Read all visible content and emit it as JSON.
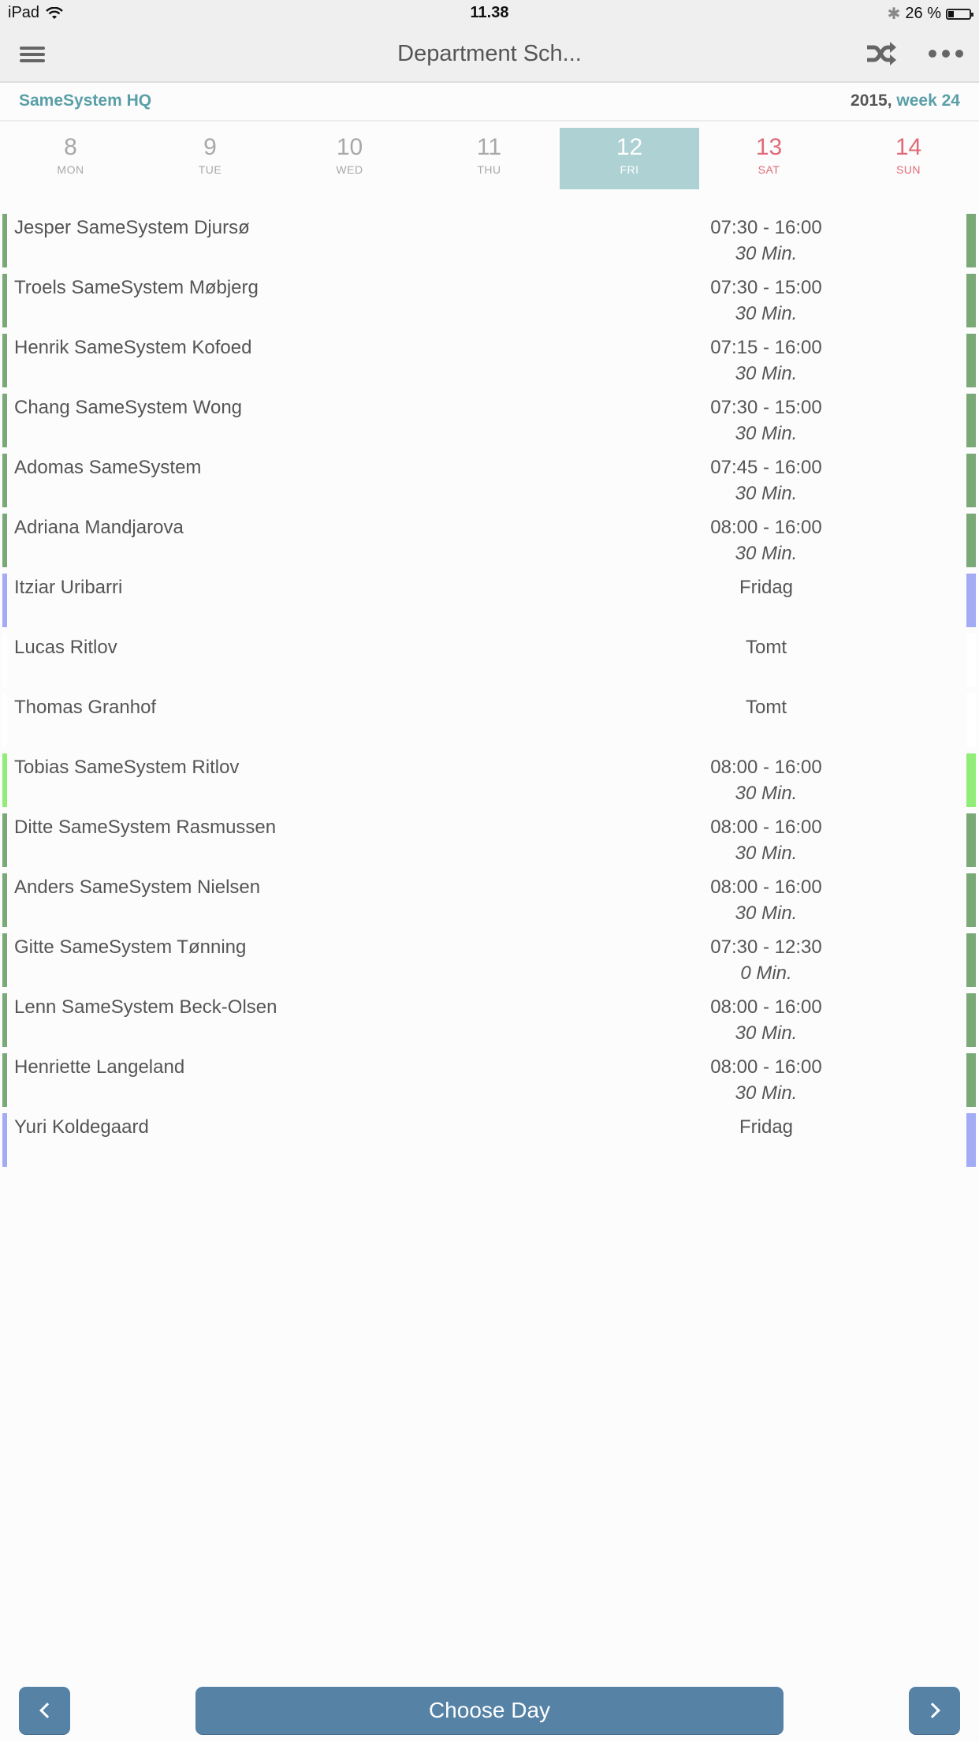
{
  "status_bar": {
    "device": "iPad",
    "time": "11.38",
    "battery_text": "26 %",
    "battery_level": 0.26
  },
  "nav": {
    "title": "Department Sch...",
    "menu_icon": "hamburger-menu-icon",
    "shuffle_icon": "shuffle-icon",
    "more_icon": "more-dots-icon"
  },
  "sub_header": {
    "department": "SameSystem HQ",
    "year": "2015,",
    "week": "week 24"
  },
  "days": [
    {
      "num": "8",
      "name": "MON",
      "weekend": false,
      "selected": false
    },
    {
      "num": "9",
      "name": "TUE",
      "weekend": false,
      "selected": false
    },
    {
      "num": "10",
      "name": "WED",
      "weekend": false,
      "selected": false
    },
    {
      "num": "11",
      "name": "THU",
      "weekend": false,
      "selected": false
    },
    {
      "num": "12",
      "name": "FRI",
      "weekend": false,
      "selected": true
    },
    {
      "num": "13",
      "name": "SAT",
      "weekend": true,
      "selected": false
    },
    {
      "num": "14",
      "name": "SUN",
      "weekend": true,
      "selected": false
    }
  ],
  "colors": {
    "shift": "#7aa977",
    "dayoff": "#a3abf5",
    "empty": "#ffffff",
    "highlight": "#90ee78",
    "accent": "#5a9fa8",
    "button": "#5682a6"
  },
  "schedule": [
    {
      "name": "Jesper SameSystem Djursø",
      "time": "07:30 - 16:00",
      "break": "30 Min.",
      "status": "shift"
    },
    {
      "name": "Troels SameSystem Møbjerg",
      "time": "07:30 - 15:00",
      "break": "30 Min.",
      "status": "shift"
    },
    {
      "name": "Henrik SameSystem Kofoed",
      "time": "07:15 - 16:00",
      "break": "30 Min.",
      "status": "shift"
    },
    {
      "name": "Chang SameSystem Wong",
      "time": "07:30 - 15:00",
      "break": "30 Min.",
      "status": "shift"
    },
    {
      "name": "Adomas SameSystem",
      "time": "07:45 - 16:00",
      "break": "30 Min.",
      "status": "shift"
    },
    {
      "name": "Adriana Mandjarova",
      "time": "08:00 - 16:00",
      "break": "30 Min.",
      "status": "shift"
    },
    {
      "name": "Itziar Uribarri",
      "time": "Fridag",
      "break": "",
      "status": "dayoff"
    },
    {
      "name": "Lucas Ritlov",
      "time": "Tomt",
      "break": "",
      "status": "empty"
    },
    {
      "name": "Thomas Granhof",
      "time": "Tomt",
      "break": "",
      "status": "empty"
    },
    {
      "name": "Tobias SameSystem Ritlov",
      "time": "08:00 - 16:00",
      "break": "30 Min.",
      "status": "highlight"
    },
    {
      "name": "Ditte SameSystem Rasmussen",
      "time": "08:00 - 16:00",
      "break": "30 Min.",
      "status": "shift"
    },
    {
      "name": "Anders SameSystem Nielsen",
      "time": "08:00 - 16:00",
      "break": "30 Min.",
      "status": "shift"
    },
    {
      "name": "Gitte SameSystem Tønning",
      "time": "07:30 - 12:30",
      "break": "0 Min.",
      "status": "shift"
    },
    {
      "name": "Lenn SameSystem Beck-Olsen",
      "time": "08:00 - 16:00",
      "break": "30 Min.",
      "status": "shift"
    },
    {
      "name": "Henriette Langeland",
      "time": "08:00 - 16:00",
      "break": "30 Min.",
      "status": "shift"
    },
    {
      "name": "Yuri Koldegaard",
      "time": "Fridag",
      "break": "",
      "status": "dayoff"
    }
  ],
  "bottom_bar": {
    "prev_icon": "chevron-left-icon",
    "choose_day_label": "Choose Day",
    "next_icon": "chevron-right-icon"
  }
}
